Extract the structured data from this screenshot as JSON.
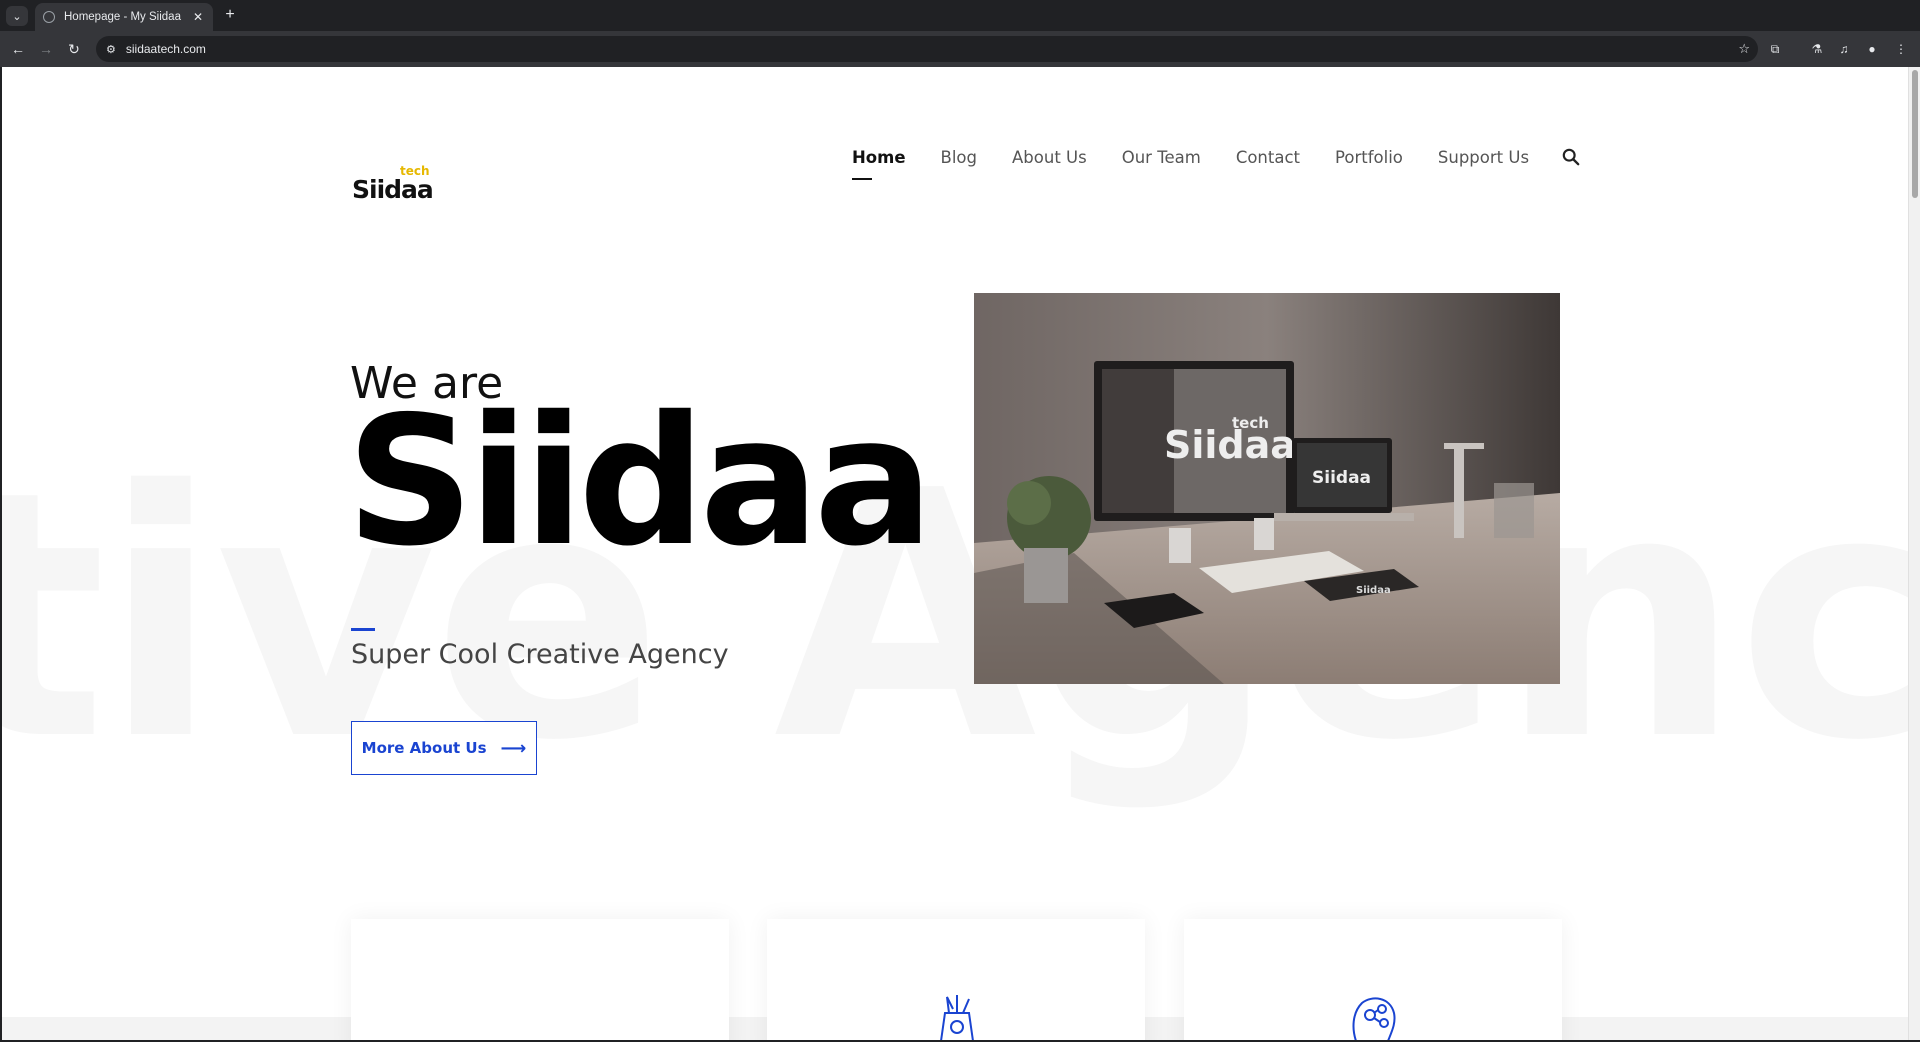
{
  "browser": {
    "tab_title": "Homepage - My Siidaa",
    "url": "siidaatech.com"
  },
  "site": {
    "logo_main": "Siidaa",
    "logo_sup": "tech",
    "nav": [
      "Home",
      "Blog",
      "About Us",
      "Our Team",
      "Contact",
      "Portfolio",
      "Support Us"
    ],
    "active_nav": "Home"
  },
  "hero": {
    "intro": "We are",
    "brand": "Siidaa",
    "tagline": "Super Cool Creative Agency",
    "cta_label": "More About Us",
    "background_text": "tive Agency C",
    "image_alt": "Desk workspace with monitor, laptop and tablet showing Siidaa tech logo",
    "image_logo_main": "Siidaa",
    "image_logo_sup": "tech"
  },
  "colors": {
    "accent": "#1a44d1",
    "logo_accent": "#e6b800"
  },
  "icons": [
    "search-icon",
    "arrow-right-icon",
    "creative-tools-icon",
    "head-network-icon"
  ]
}
